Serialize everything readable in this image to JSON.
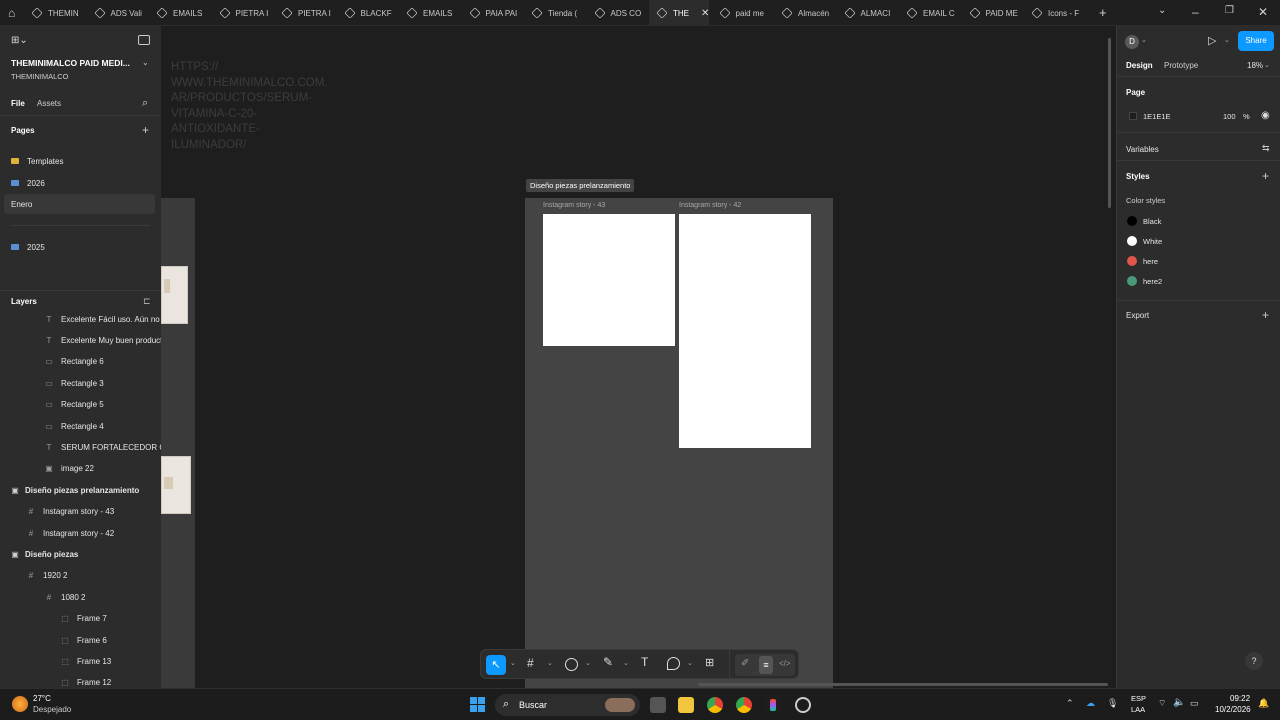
{
  "tabs": [
    {
      "label": "THEMIN",
      "active": false
    },
    {
      "label": "ADS Vali",
      "active": false
    },
    {
      "label": "EMAILS",
      "active": false
    },
    {
      "label": "PIETRA I",
      "active": false
    },
    {
      "label": "PIETRA I",
      "active": false
    },
    {
      "label": "BLACKF",
      "active": false
    },
    {
      "label": "EMAILS",
      "active": false
    },
    {
      "label": "PAIA PAI",
      "active": false
    },
    {
      "label": "Tienda (",
      "active": false
    },
    {
      "label": "ADS CO",
      "active": false
    },
    {
      "label": "THE",
      "active": true
    },
    {
      "label": "paid me",
      "active": false
    },
    {
      "label": "Almacén",
      "active": false
    },
    {
      "label": "ALMACI",
      "active": false
    },
    {
      "label": "EMAIL C",
      "active": false
    },
    {
      "label": "PAID ME",
      "active": false
    },
    {
      "label": "Icons - F",
      "active": false
    }
  ],
  "left": {
    "file_title": "THEMINIMALCO PAID MEDI...",
    "team": "THEMINIMALCO",
    "file_tab": "File",
    "assets_tab": "Assets",
    "pages_title": "Pages",
    "pages": [
      "Templates",
      "2026",
      "Enero",
      "2025"
    ],
    "layers_title": "Layers",
    "layers": [
      {
        "label": "Excelente Fácil uso. Aún no v",
        "glyph": "T"
      },
      {
        "label": "Excelente Muy buen producto",
        "glyph": "T"
      },
      {
        "label": "Rectangle 6",
        "glyph": "▭"
      },
      {
        "label": "Rectangle 3",
        "glyph": "▭"
      },
      {
        "label": "Rectangle 5",
        "glyph": "▭"
      },
      {
        "label": "Rectangle 4",
        "glyph": "▭"
      },
      {
        "label": "SERUM FORTALECEDOR Ceja",
        "glyph": "T"
      },
      {
        "label": "image 22",
        "glyph": "▣"
      },
      {
        "label": "Diseño piezas prelanzamiento",
        "glyph": "▣"
      },
      {
        "label": "Instagram story - 43",
        "glyph": "#"
      },
      {
        "label": "Instagram story - 42",
        "glyph": "#"
      },
      {
        "label": "Diseño piezas",
        "glyph": "▣"
      },
      {
        "label": "1920 2",
        "glyph": "#"
      },
      {
        "label": "1080 2",
        "glyph": "#"
      },
      {
        "label": "Frame 7",
        "glyph": "⬚"
      },
      {
        "label": "Frame 6",
        "glyph": "⬚"
      },
      {
        "label": "Frame 13",
        "glyph": "⬚"
      },
      {
        "label": "Frame 12",
        "glyph": "⬚"
      }
    ]
  },
  "canvas": {
    "url_text": "HTTPS://\nWWW.THEMINIMALCO.COM.\nAR/PRODUCTOS/SERUM-\nVITAMINA-C-20-\nANTIOXIDANTE-\nILUMINADOR/",
    "section_label": "Diseño piezas prelanzamiento",
    "frame_a": "Instagram story - 43",
    "frame_b": "Instagram story - 42"
  },
  "right": {
    "design_tab": "Design",
    "prototype_tab": "Prototype",
    "zoom": "18%",
    "avatar": "D",
    "share": "Share",
    "page_title": "Page",
    "page_color": "1E1E1E",
    "page_opacity": "100",
    "percent": "%",
    "variables": "Variables",
    "styles": "Styles",
    "color_styles": "Color styles",
    "colors": [
      {
        "name": "Black",
        "hex": "#000000"
      },
      {
        "name": "White",
        "hex": "#ffffff"
      },
      {
        "name": "here",
        "hex": "#e2554b"
      },
      {
        "name": "here2",
        "hex": "#4a9a7a"
      }
    ],
    "export": "Export"
  },
  "taskbar": {
    "temp": "27°C",
    "weather": "Despejado",
    "search": "Buscar",
    "lang1": "ESP",
    "lang2": "LAA",
    "time": "09:22",
    "date": "10/2/2026"
  }
}
